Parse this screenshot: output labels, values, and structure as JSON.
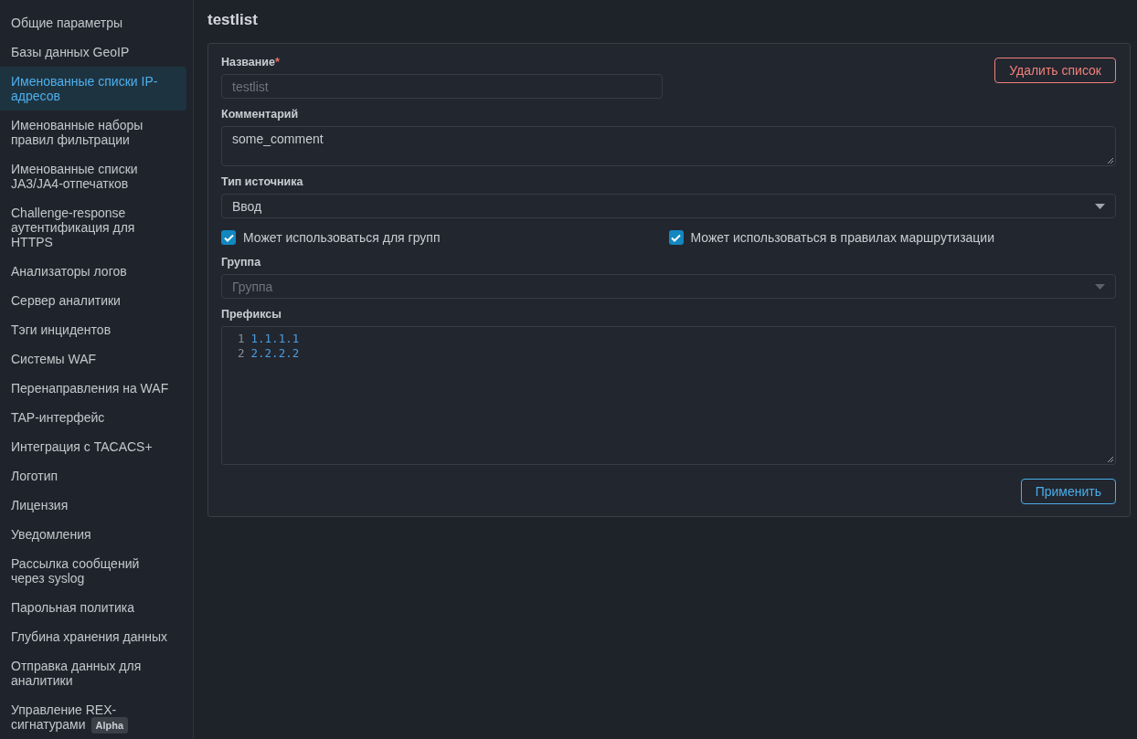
{
  "sidebar": {
    "items": [
      {
        "label": "Общие параметры",
        "selected": false
      },
      {
        "label": "Базы данных GeoIP",
        "selected": false
      },
      {
        "label": "Именованные списки IP-адресов",
        "selected": true
      },
      {
        "label": "Именованные наборы правил фильтрации",
        "selected": false
      },
      {
        "label": "Именованные списки JA3/JA4-отпечатков",
        "selected": false
      },
      {
        "label": "Challenge-response аутентификация для HTTPS",
        "selected": false
      },
      {
        "label": "Анализаторы логов",
        "selected": false
      },
      {
        "label": "Сервер аналитики",
        "selected": false
      },
      {
        "label": "Тэги инцидентов",
        "selected": false
      },
      {
        "label": "Системы WAF",
        "selected": false
      },
      {
        "label": "Перенаправления на WAF",
        "selected": false
      },
      {
        "label": "TAP-интерфейс",
        "selected": false
      },
      {
        "label": "Интеграция с TACACS+",
        "selected": false
      },
      {
        "label": "Логотип",
        "selected": false
      },
      {
        "label": "Лицензия",
        "selected": false
      },
      {
        "label": "Уведомления",
        "selected": false
      },
      {
        "label": "Рассылка сообщений через syslog",
        "selected": false
      },
      {
        "label": "Парольная политика",
        "selected": false
      },
      {
        "label": "Глубина хранения данных",
        "selected": false
      },
      {
        "label": "Отправка данных для аналитики",
        "selected": false
      },
      {
        "label": "Управление REX-сигнатурами",
        "selected": false,
        "badge": "Alpha"
      }
    ]
  },
  "page": {
    "title": "testlist",
    "name": {
      "label": "Название",
      "required_mark": "*",
      "value": "testlist",
      "disabled": true
    },
    "delete_button": "Удалить список",
    "comment": {
      "label": "Комментарий",
      "value": "some_comment"
    },
    "source_type": {
      "label": "Тип источника",
      "value": "Ввод"
    },
    "checkboxes": [
      {
        "label": "Может использоваться для групп",
        "checked": true
      },
      {
        "label": "Может использоваться в правилах маршрутизации",
        "checked": true
      }
    ],
    "group": {
      "label": "Группа",
      "placeholder": "Группа",
      "disabled": true
    },
    "prefixes": {
      "label": "Префиксы",
      "lines": [
        {
          "number": "1",
          "text": "1.1.1.1"
        },
        {
          "number": "2",
          "text": "2.2.2.2"
        }
      ]
    },
    "apply_button": "Применить"
  }
}
